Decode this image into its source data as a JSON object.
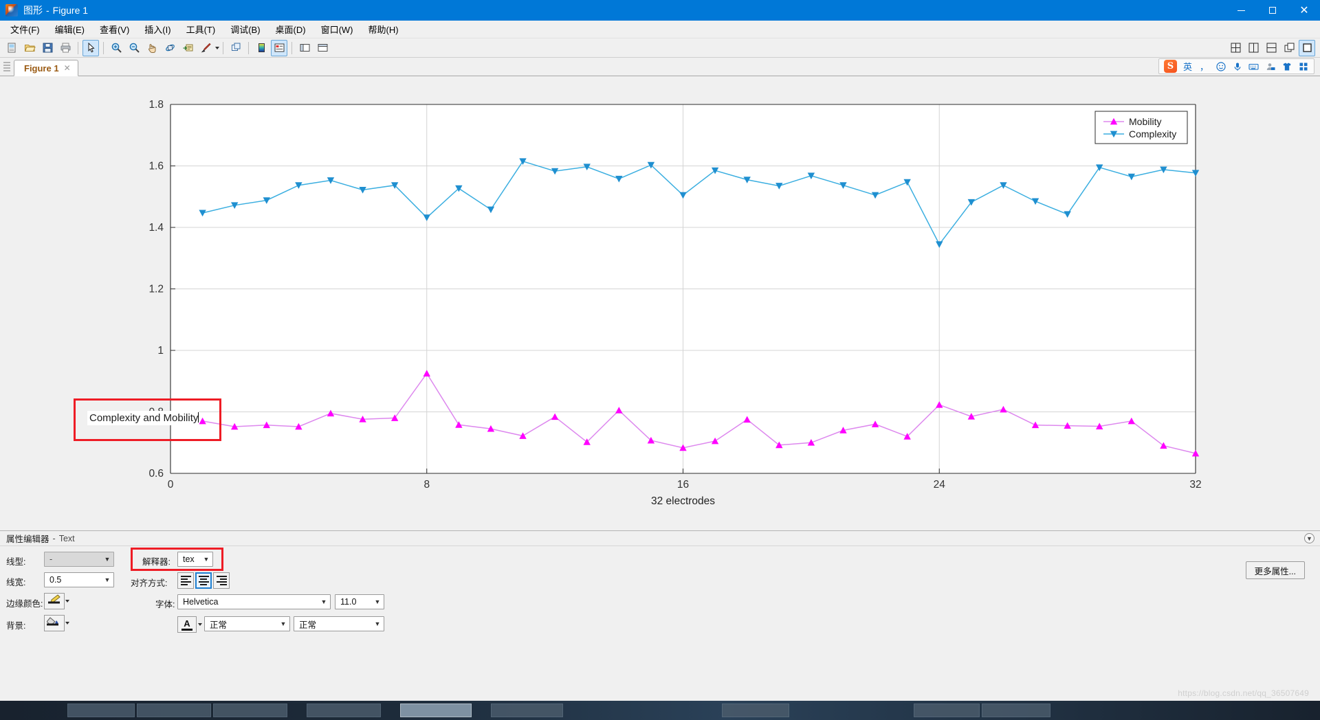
{
  "window": {
    "title_prefix": "图形",
    "title_dash": "-",
    "title_name": "Figure 1",
    "minimize": "—",
    "maximize": "□",
    "close": "✕"
  },
  "menubar": {
    "items": [
      {
        "label": "文件(F)",
        "name": "menu-file"
      },
      {
        "label": "编辑(E)",
        "name": "menu-edit"
      },
      {
        "label": "查看(V)",
        "name": "menu-view"
      },
      {
        "label": "插入(I)",
        "name": "menu-insert"
      },
      {
        "label": "工具(T)",
        "name": "menu-tools"
      },
      {
        "label": "调试(B)",
        "name": "menu-debug"
      },
      {
        "label": "桌面(D)",
        "name": "menu-desktop"
      },
      {
        "label": "窗口(W)",
        "name": "menu-window"
      },
      {
        "label": "帮助(H)",
        "name": "menu-help"
      }
    ]
  },
  "toolbar": {
    "left_icons": [
      "new-figure-icon",
      "open-file-icon",
      "save-icon",
      "print-icon",
      "pointer-icon",
      "zoom-in-icon",
      "zoom-out-icon",
      "pan-icon",
      "rotate-3d-icon",
      "data-cursor-icon",
      "brush-icon",
      "link-plot-icon",
      "colorbar-icon",
      "legend-icon",
      "hide-plot-tools-icon",
      "show-plot-tools-icon"
    ],
    "right_icons": [
      "tile-grid-icon",
      "tile-vertical-icon",
      "tile-horizontal-icon",
      "cascade-icon",
      "maximize-pane-icon"
    ]
  },
  "tabs": {
    "items": [
      {
        "label": "Figure 1",
        "close": "✕"
      }
    ]
  },
  "ime": {
    "logo": "S",
    "icons": [
      {
        "name": "ime-lang-english",
        "glyph": "英"
      },
      {
        "name": "ime-punctuation-icon",
        "glyph": "，"
      },
      {
        "name": "ime-emoji-icon",
        "glyph": "☺"
      },
      {
        "name": "ime-voice-input-icon",
        "glyph": "🎙"
      },
      {
        "name": "ime-soft-keyboard-icon",
        "glyph": "⌨"
      },
      {
        "name": "ime-user-icon",
        "glyph": "👤"
      },
      {
        "name": "ime-skin-icon",
        "glyph": "👕"
      },
      {
        "name": "ime-toolbox-icon",
        "glyph": "▦"
      }
    ]
  },
  "figure": {
    "annotation_textbox": {
      "text": "Complexity and Mobility",
      "selected": true
    }
  },
  "chart_data": {
    "type": "line",
    "title": "",
    "xlabel": "32 electrodes",
    "ylabel": "",
    "xlim": [
      0,
      32
    ],
    "ylim": [
      0.6,
      1.8
    ],
    "xticks": [
      0,
      8,
      16,
      24,
      32
    ],
    "yticks": [
      0.6,
      0.8,
      1,
      1.2,
      1.4,
      1.6,
      1.8
    ],
    "xtick_labels": [
      "0",
      "8",
      "16",
      "24",
      "32"
    ],
    "ytick_labels": [
      "0.6",
      "0.8",
      "1",
      "1.2",
      "1.4",
      "1.6",
      "1.8"
    ],
    "grid": true,
    "legend_position": "top-right",
    "x": [
      1,
      2,
      3,
      4,
      5,
      6,
      7,
      8,
      9,
      10,
      11,
      12,
      13,
      14,
      15,
      16,
      17,
      18,
      19,
      20,
      21,
      22,
      23,
      24,
      25,
      26,
      27,
      28,
      29,
      30,
      31,
      32
    ],
    "series": [
      {
        "name": "Mobility",
        "color": "#ff00ff",
        "line_color": "#dd88ee",
        "marker": "triangle-up",
        "values": [
          0.77,
          0.752,
          0.757,
          0.752,
          0.795,
          0.776,
          0.78,
          0.925,
          0.758,
          0.745,
          0.722,
          0.784,
          0.702,
          0.805,
          0.707,
          0.683,
          0.705,
          0.775,
          0.692,
          0.7,
          0.74,
          0.76,
          0.72,
          0.823,
          0.785,
          0.808,
          0.757,
          0.755,
          0.753,
          0.77,
          0.69,
          0.665
        ]
      },
      {
        "name": "Complexity",
        "color": "#1f8fd0",
        "line_color": "#3aaee0",
        "marker": "triangle-down",
        "values": [
          1.447,
          1.472,
          1.488,
          1.537,
          1.553,
          1.522,
          1.537,
          1.432,
          1.527,
          1.458,
          1.615,
          1.583,
          1.597,
          1.558,
          1.603,
          1.505,
          1.585,
          1.555,
          1.535,
          1.568,
          1.537,
          1.505,
          1.547,
          1.345,
          1.482,
          1.537,
          1.485,
          1.443,
          1.595,
          1.565,
          1.588,
          1.577
        ]
      }
    ]
  },
  "property_editor": {
    "header_title": "属性编辑器",
    "header_dash": "-",
    "header_object": "Text",
    "collapse_glyph": "▼",
    "fields": {
      "linestyle_label": "线型:",
      "linestyle_value": "-",
      "linewidth_label": "线宽:",
      "linewidth_value": "0.5",
      "edgecolor_label": "边缘颜色:",
      "background_label": "背景:",
      "interpreter_label": "解释器:",
      "interpreter_value": "tex",
      "alignment_label": "对齐方式:",
      "font_label": "字体:",
      "font_value": "Helvetica",
      "fontsize_value": "11.0",
      "fontweight_value": "正常",
      "fontangle_value": "正常"
    },
    "more_properties": "更多属性..."
  },
  "watermark": {
    "text": "https://blog.csdn.net/qq_36507649"
  }
}
